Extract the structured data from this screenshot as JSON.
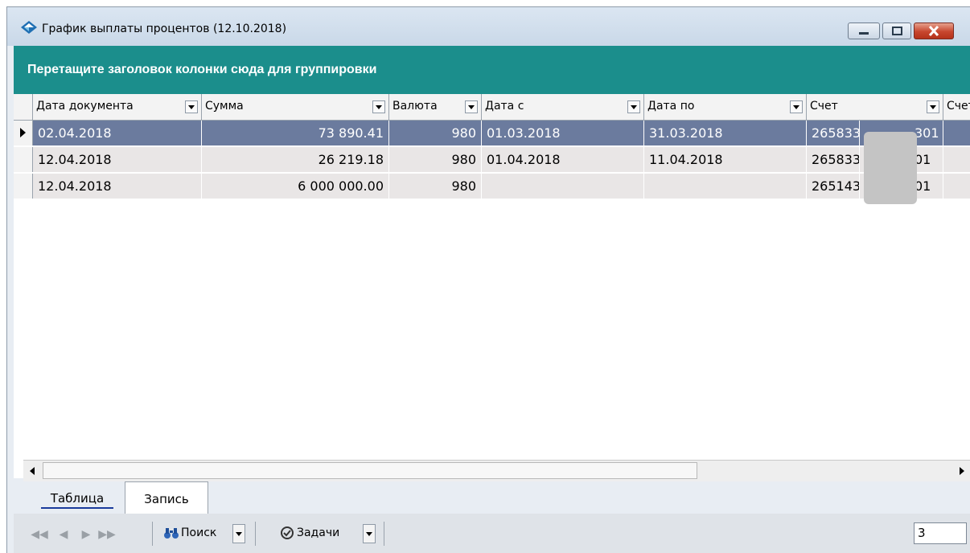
{
  "window": {
    "title": "График выплаты процентов (12.10.2018)",
    "controls": [
      "minimize",
      "maximize",
      "close"
    ]
  },
  "group_panel": {
    "text": "Перетащите заголовок колонки сюда для группировки"
  },
  "grid": {
    "columns": [
      "Дата документа",
      "Сумма",
      "Валюта",
      "Дата с",
      "Дата по",
      "Счет",
      "Счет"
    ],
    "rows": [
      {
        "date_doc": "02.04.2018",
        "sum": "73 890.41",
        "currency": "980",
        "date_from": "01.03.2018",
        "date_to": "31.03.2018",
        "account_start": "265833",
        "account_end": "301",
        "selected": true
      },
      {
        "date_doc": "12.04.2018",
        "sum": "26 219.18",
        "currency": "980",
        "date_from": "01.04.2018",
        "date_to": "11.04.2018",
        "account_start": "265833",
        "account_end": "01",
        "selected": false
      },
      {
        "date_doc": "12.04.2018",
        "sum": "6 000 000.00",
        "currency": "980",
        "date_from": "",
        "date_to": "",
        "account_start": "265143",
        "account_end": "01",
        "selected": false
      }
    ]
  },
  "tabs": [
    {
      "label": "Таблица",
      "active": false
    },
    {
      "label": "Запись",
      "active": true
    }
  ],
  "toolbar": {
    "search_label": "Поиск",
    "tasks_label": "Задачи",
    "record_count": "3"
  },
  "colors": {
    "accent": "#1b8e8c",
    "selection": "#6b7b9e",
    "row": "#e9e6e6"
  }
}
